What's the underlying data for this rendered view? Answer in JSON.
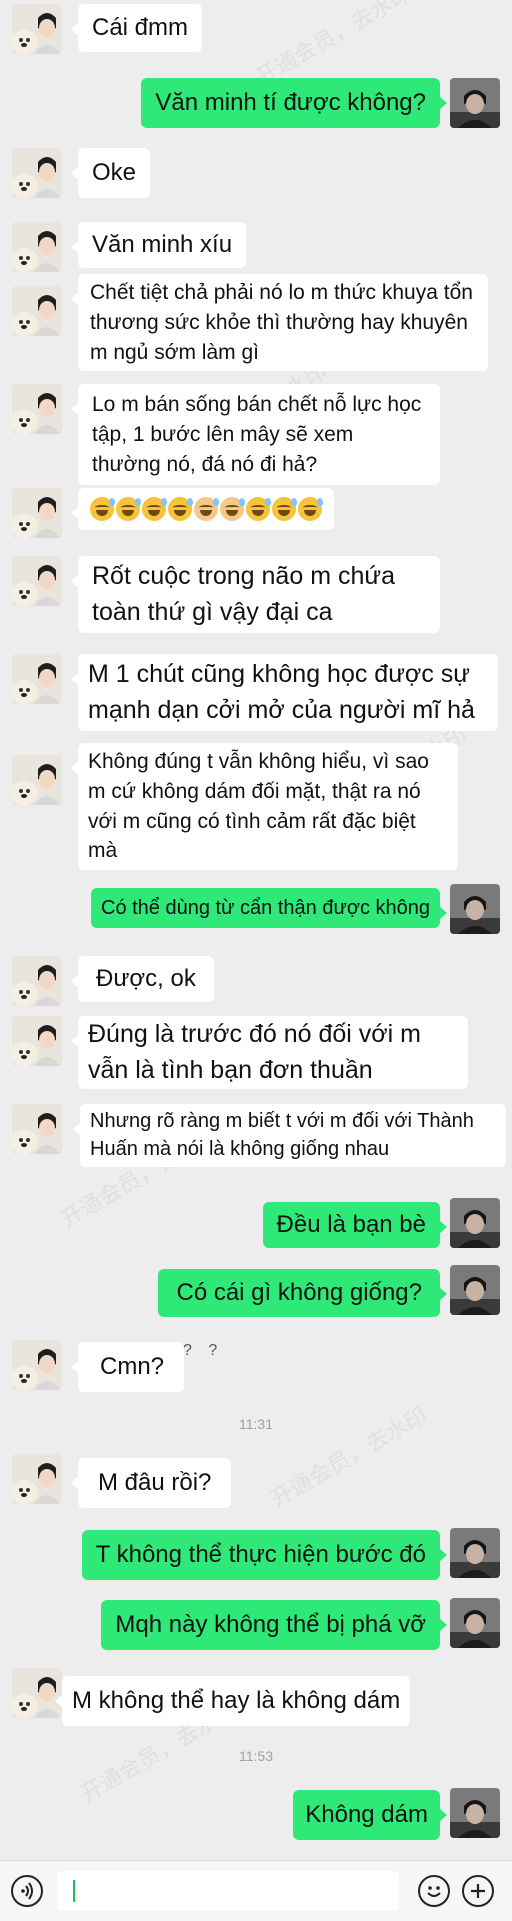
{
  "colors": {
    "background": "#ededed",
    "incoming_bubble": "#ffffff",
    "outgoing_bubble": "#2ee877",
    "timestamp": "#a0a0a0"
  },
  "messages": [
    {
      "side": "in",
      "text": "Cái đmm"
    },
    {
      "side": "out",
      "text": "Văn minh tí được không?"
    },
    {
      "side": "in",
      "text": "Oke"
    },
    {
      "side": "in",
      "text": "Văn minh xíu"
    },
    {
      "side": "in",
      "text": "Chết tiệt chả phải nó lo m thức khuya tổn thương sức khỏe thì thường hay khuyên m ngủ sớm làm gì"
    },
    {
      "side": "in",
      "text": "Lo m bán sống bán chết nỗ lực học tập, 1 bước lên mây sẽ xem thường nó, đá nó đi hả?"
    },
    {
      "side": "in",
      "text": ""
    },
    {
      "side": "in",
      "text": "Rốt cuộc trong não m chứa toàn thứ gì vậy đại ca"
    },
    {
      "side": "in",
      "text": "M 1 chút cũng không học được sự mạnh dạn cởi mở của người mĩ hả"
    },
    {
      "side": "in",
      "text": "Không đúng t vẫn không hiểu, vì sao m cứ không dám đối mặt, thật ra nó với m cũng có tình cảm rất đặc biệt mà"
    },
    {
      "side": "out",
      "text": "Có thể dùng từ cẩn thận được không"
    },
    {
      "side": "in",
      "text": "Được, ok"
    },
    {
      "side": "in",
      "text": "Đúng là trước đó nó đối với m vẫn là tình bạn đơn thuần"
    },
    {
      "side": "in",
      "text": "Nhưng rõ ràng m biết t với m đối với Thành Huấn mà nói là không giống nhau"
    },
    {
      "side": "out",
      "text": "Đều là bạn bè"
    },
    {
      "side": "out",
      "text": "Có cái gì không giống?"
    },
    {
      "side": "in",
      "text": "Cmn?"
    },
    {
      "side": "in",
      "text": "M đâu rồi?"
    },
    {
      "side": "out",
      "text": "T không thể thực hiện bước đó"
    },
    {
      "side": "out",
      "text": "Mqh này không thể bị phá vỡ"
    },
    {
      "side": "in",
      "text": "M không thể hay là không dám"
    },
    {
      "side": "out",
      "text": "Không dám"
    }
  ],
  "question_marks": "? ?",
  "timestamps": [
    "11:31",
    "11:53"
  ],
  "emoji_row": [
    "sweat-smile",
    "sweat-smile",
    "sweat-smile",
    "sweat-smile",
    "sweat-smile",
    "sweat-smile",
    "sweat-smile",
    "sweat-smile",
    "sweat-smile"
  ],
  "watermark": "开通会员，去水印",
  "bottom_bar": {
    "voice_icon": "voice-icon",
    "emoji_icon": "emoji-icon",
    "plus_icon": "plus-icon",
    "input_value": ""
  }
}
